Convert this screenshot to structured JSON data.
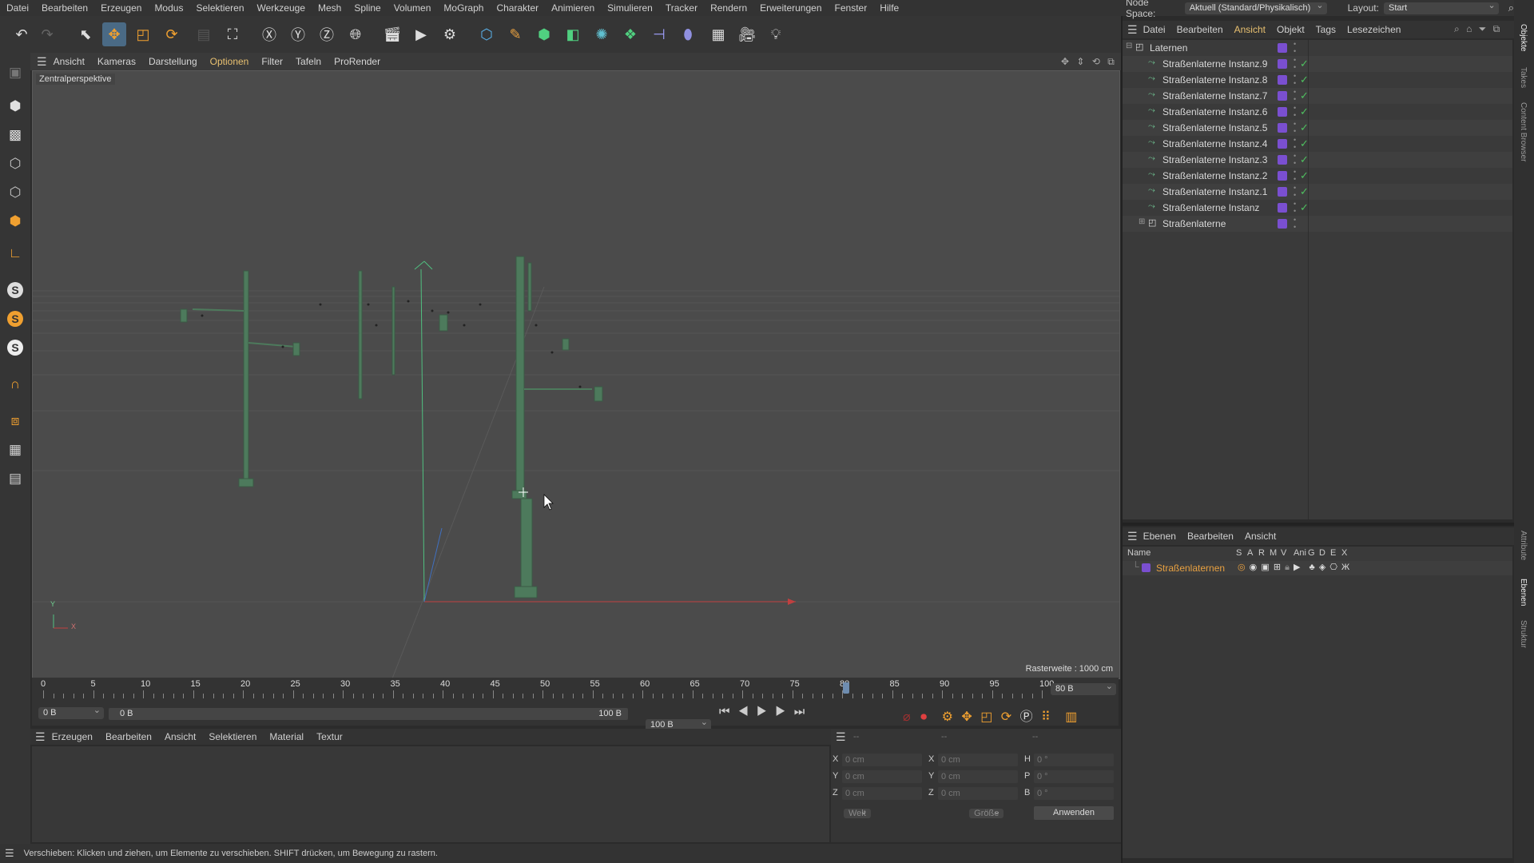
{
  "menu": {
    "items": [
      "Datei",
      "Bearbeiten",
      "Erzeugen",
      "Modus",
      "Selektieren",
      "Werkzeuge",
      "Mesh",
      "Spline",
      "Volumen",
      "MoGraph",
      "Charakter",
      "Animieren",
      "Simulieren",
      "Tracker",
      "Rendern",
      "Erweiterungen",
      "Fenster",
      "Hilfe"
    ]
  },
  "nodespace": {
    "label": "Node Space:",
    "value": "Aktuell (Standard/Physikalisch)",
    "layout_label": "Layout:",
    "layout_value": "Start"
  },
  "toolbar": {
    "undo": "↶",
    "redo": "↷"
  },
  "viewport": {
    "menu": [
      "Ansicht",
      "Kameras",
      "Darstellung",
      "Optionen",
      "Filter",
      "Tafeln",
      "ProRender"
    ],
    "camera_label": "Zentralperspektive",
    "grid_info": "Rasterweite : 1000 cm",
    "axis_y": "Y",
    "axis_x": "X"
  },
  "timeline": {
    "ticks": [
      "0",
      "5",
      "10",
      "15",
      "20",
      "25",
      "30",
      "35",
      "40",
      "45",
      "50",
      "55",
      "60",
      "65",
      "70",
      "75",
      "80",
      "85",
      "90",
      "95",
      "100"
    ],
    "current_frame": "80 B",
    "start": "0 B",
    "range_start": "0 B",
    "range_end": "100 B",
    "end": "100 B"
  },
  "material": {
    "menu": [
      "Erzeugen",
      "Bearbeiten",
      "Ansicht",
      "Selektieren",
      "Material",
      "Textur"
    ]
  },
  "coords": {
    "header_dash1": "--",
    "header_dash2": "--",
    "header_dash3": "--",
    "labels_pos": [
      "X",
      "Y",
      "Z"
    ],
    "labels_size": [
      "X",
      "Y",
      "Z"
    ],
    "labels_rot": [
      "H",
      "P",
      "B"
    ],
    "pos_values": [
      "0 cm",
      "0 cm",
      "0 cm"
    ],
    "size_values": [
      "0 cm",
      "0 cm",
      "0 cm"
    ],
    "rot_values": [
      "0 °",
      "0 °",
      "0 °"
    ],
    "mode1": "Welt",
    "mode2": "Größe",
    "apply": "Anwenden"
  },
  "status": {
    "text": "Verschieben: Klicken und ziehen, um Elemente zu verschieben. SHIFT drücken, um Bewegung zu rastern."
  },
  "objects": {
    "menu": [
      "Datei",
      "Bearbeiten",
      "Ansicht",
      "Objekt",
      "Tags",
      "Lesezeichen"
    ],
    "rows": [
      {
        "name": "Laternen",
        "indent": 0
      },
      {
        "name": "Straßenlaterne Instanz.9",
        "indent": 1
      },
      {
        "name": "Straßenlaterne Instanz.8",
        "indent": 1
      },
      {
        "name": "Straßenlaterne Instanz.7",
        "indent": 1
      },
      {
        "name": "Straßenlaterne Instanz.6",
        "indent": 1
      },
      {
        "name": "Straßenlaterne Instanz.5",
        "indent": 1
      },
      {
        "name": "Straßenlaterne Instanz.4",
        "indent": 1
      },
      {
        "name": "Straßenlaterne Instanz.3",
        "indent": 1
      },
      {
        "name": "Straßenlaterne Instanz.2",
        "indent": 1
      },
      {
        "name": "Straßenlaterne Instanz.1",
        "indent": 1
      },
      {
        "name": "Straßenlaterne Instanz",
        "indent": 1
      },
      {
        "name": "Straßenlaterne",
        "indent": 1
      }
    ]
  },
  "layers": {
    "menu": [
      "Ebenen",
      "Bearbeiten",
      "Ansicht"
    ],
    "header_name": "Name",
    "columns": [
      "S",
      "A",
      "R",
      "M",
      "V",
      "Ani",
      "G",
      "D",
      "E",
      "X"
    ],
    "rows": [
      {
        "name": "Straßenlaternen"
      }
    ]
  },
  "sidetabs": [
    "Objekte",
    "Takes",
    "Content Browser",
    "Attribute",
    "Ebenen",
    "Struktur"
  ],
  "colors": {
    "accent": "#e8c070",
    "layer": "#7a4fd0",
    "lantern": "#4d7a5c",
    "check": "#4fc060"
  }
}
